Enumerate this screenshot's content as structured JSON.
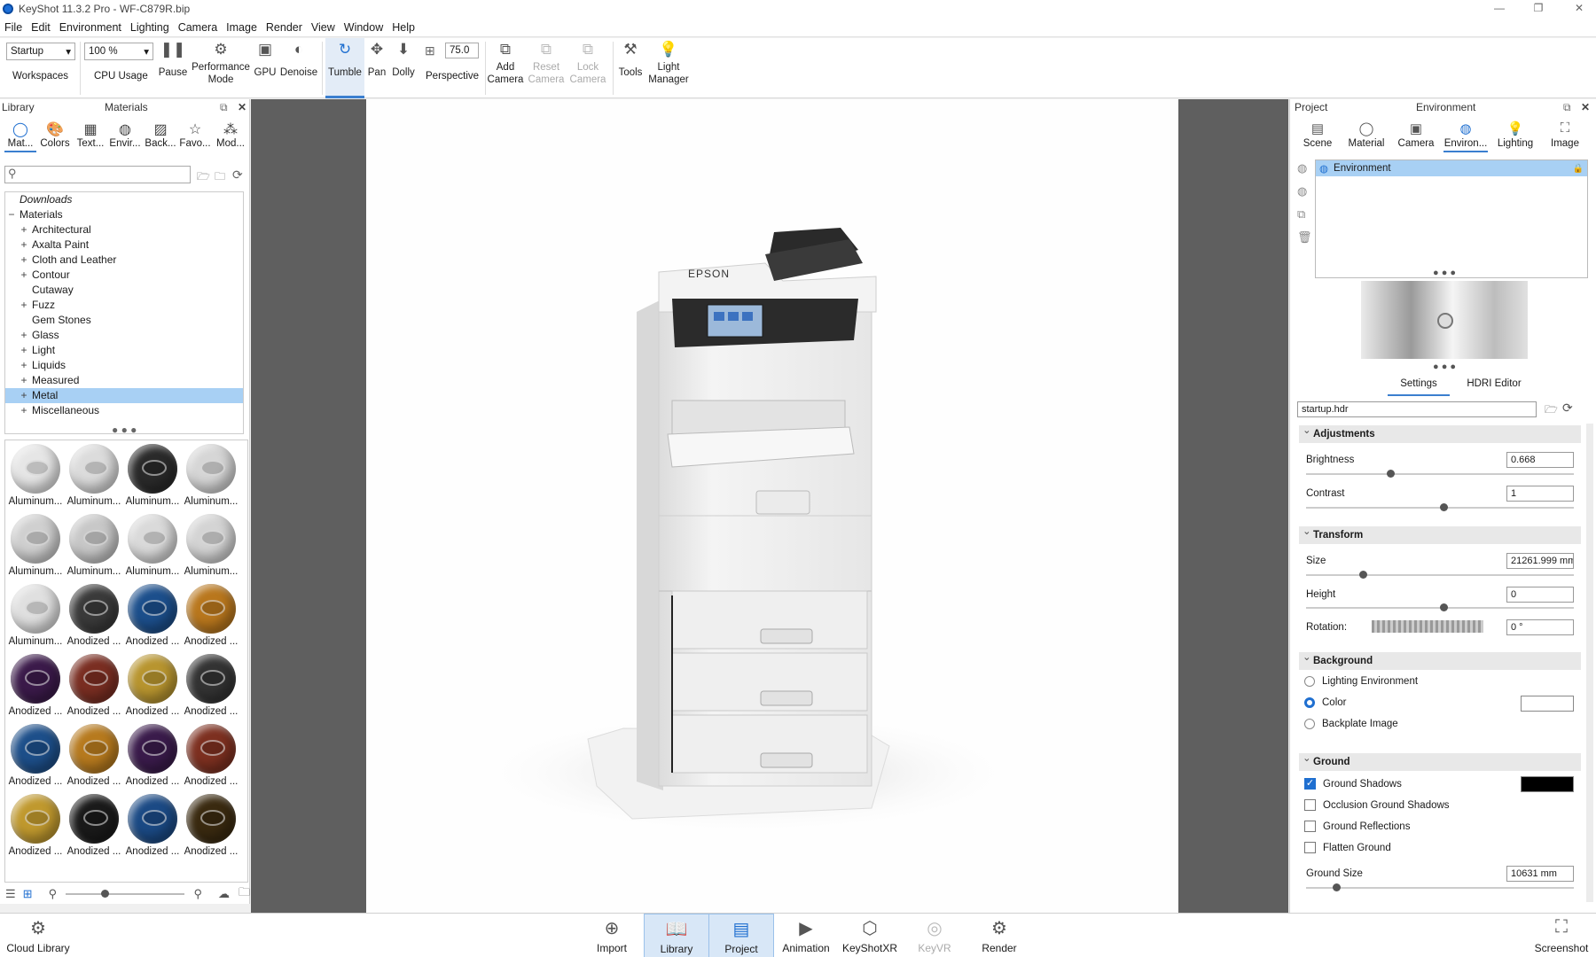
{
  "window": {
    "title": "KeyShot 11.3.2 Pro  - WF-C879R.bip"
  },
  "menu": [
    "File",
    "Edit",
    "Environment",
    "Lighting",
    "Camera",
    "Image",
    "Render",
    "View",
    "Window",
    "Help"
  ],
  "toolbar": {
    "workspace_value": "Startup",
    "workspace_label": "Workspaces",
    "cpu_value": "100 %",
    "cpu_label": "CPU Usage",
    "pause": "Pause",
    "perf1": "Performance",
    "perf2": "Mode",
    "gpu": "GPU",
    "denoise": "Denoise",
    "tumble": "Tumble",
    "pan": "Pan",
    "dolly": "Dolly",
    "fov_value": "75.0",
    "perspective": "Perspective",
    "add1": "Add",
    "add2": "Camera",
    "reset1": "Reset",
    "reset2": "Camera",
    "lock1": "Lock",
    "lock2": "Camera",
    "tools": "Tools",
    "lm1": "Light",
    "lm2": "Manager"
  },
  "library": {
    "header_left": "Library",
    "header_center": "Materials",
    "tabs": [
      "Mat...",
      "Colors",
      "Text...",
      "Envir...",
      "Back...",
      "Favo...",
      "Mod..."
    ],
    "search_placeholder": "",
    "tree": [
      {
        "label": "Downloads",
        "italic": true,
        "expander": ""
      },
      {
        "label": "Materials",
        "expander": "−",
        "root": true
      },
      {
        "label": "Architectural",
        "expander": "+"
      },
      {
        "label": "Axalta Paint",
        "expander": "+"
      },
      {
        "label": "Cloth and Leather",
        "expander": "+"
      },
      {
        "label": "Contour",
        "expander": "+"
      },
      {
        "label": "Cutaway",
        "expander": ""
      },
      {
        "label": "Fuzz",
        "expander": "+"
      },
      {
        "label": "Gem Stones",
        "expander": ""
      },
      {
        "label": "Glass",
        "expander": "+"
      },
      {
        "label": "Light",
        "expander": "+"
      },
      {
        "label": "Liquids",
        "expander": "+"
      },
      {
        "label": "Measured",
        "expander": "+"
      },
      {
        "label": "Metal",
        "expander": "+",
        "selected": true
      },
      {
        "label": "Miscellaneous",
        "expander": "+"
      }
    ],
    "materials": [
      {
        "label": "Aluminum...",
        "color": "#e6e6e6"
      },
      {
        "label": "Aluminum...",
        "color": "#dcdcdc"
      },
      {
        "label": "Aluminum...",
        "color": "#2a2a2a"
      },
      {
        "label": "Aluminum...",
        "color": "#d6d6d6"
      },
      {
        "label": "Aluminum...",
        "color": "#d0d0d0"
      },
      {
        "label": "Aluminum...",
        "color": "#c8c8c8"
      },
      {
        "label": "Aluminum...",
        "color": "#dadada"
      },
      {
        "label": "Aluminum...",
        "color": "#d4d4d4"
      },
      {
        "label": "Aluminum...",
        "color": "#e0e0e0"
      },
      {
        "label": "Anodized ...",
        "color": "#3a3a3a"
      },
      {
        "label": "Anodized ...",
        "color": "#1c4f8c"
      },
      {
        "label": "Anodized ...",
        "color": "#b9771d"
      },
      {
        "label": "Anodized ...",
        "color": "#3b1a4a"
      },
      {
        "label": "Anodized ...",
        "color": "#7a2e22"
      },
      {
        "label": "Anodized ...",
        "color": "#b8952f"
      },
      {
        "label": "Anodized ...",
        "color": "#333333"
      },
      {
        "label": "Anodized ...",
        "color": "#1d4f8a"
      },
      {
        "label": "Anodized ...",
        "color": "#b77a1e"
      },
      {
        "label": "Anodized ...",
        "color": "#3a1b4b"
      },
      {
        "label": "Anodized ...",
        "color": "#7d3020"
      },
      {
        "label": "Anodized ...",
        "color": "#c0992e"
      },
      {
        "label": "Anodized ...",
        "color": "#1a1a1a"
      },
      {
        "label": "Anodized ...",
        "color": "#1b4a85"
      },
      {
        "label": "Anodized ...",
        "color": "#3a2a10"
      }
    ]
  },
  "viewport": {
    "brand": "EPSON"
  },
  "project": {
    "header_left": "Project",
    "header_center": "Environment",
    "tabs": [
      "Scene",
      "Material",
      "Camera",
      "Environ...",
      "Lighting",
      "Image"
    ],
    "env_item": "Environment",
    "subtabs": [
      "Settings",
      "HDRI Editor"
    ],
    "hdr_file": "startup.hdr",
    "adjustments": "Adjustments",
    "brightness_label": "Brightness",
    "brightness": "0.668",
    "brightness_level": 0.3,
    "contrast_label": "Contrast",
    "contrast": "1",
    "contrast_level": 0.5,
    "transform": "Transform",
    "size_label": "Size",
    "size": "21261.999 mm",
    "size_level": 0.2,
    "height_label": "Height",
    "height": "0",
    "height_level": 0.5,
    "rotation_label": "Rotation:",
    "rotation": "0 °",
    "background": "Background",
    "bg_options": [
      "Lighting Environment",
      "Color",
      "Backplate Image"
    ],
    "bg_selected": 1,
    "bg_color": "#ffffff",
    "ground": "Ground",
    "ground_options": [
      {
        "label": "Ground Shadows",
        "checked": true
      },
      {
        "label": "Occlusion Ground Shadows",
        "checked": false
      },
      {
        "label": "Ground Reflections",
        "checked": false
      },
      {
        "label": "Flatten Ground",
        "checked": false
      }
    ],
    "shadow_color": "#000000",
    "ground_size_label": "Ground Size",
    "ground_size": "10631 mm",
    "ground_size_level": 0.1
  },
  "bottom": {
    "cloud": "Cloud Library",
    "buttons": [
      {
        "label": "Import",
        "state": "normal",
        "icon": "import-icon"
      },
      {
        "label": "Library",
        "state": "active",
        "icon": "library-icon"
      },
      {
        "label": "Project",
        "state": "active",
        "icon": "project-icon"
      },
      {
        "label": "Animation",
        "state": "normal",
        "icon": "animation-icon"
      },
      {
        "label": "KeyShotXR",
        "state": "normal",
        "icon": "keyshotxr-icon"
      },
      {
        "label": "KeyVR",
        "state": "disabled",
        "icon": "keyvr-icon"
      },
      {
        "label": "Render",
        "state": "normal",
        "icon": "render-icon"
      }
    ],
    "screenshot": "Screenshot"
  },
  "colors": {
    "accent": "#1f6fd0",
    "selection": "#a8d0f4"
  }
}
